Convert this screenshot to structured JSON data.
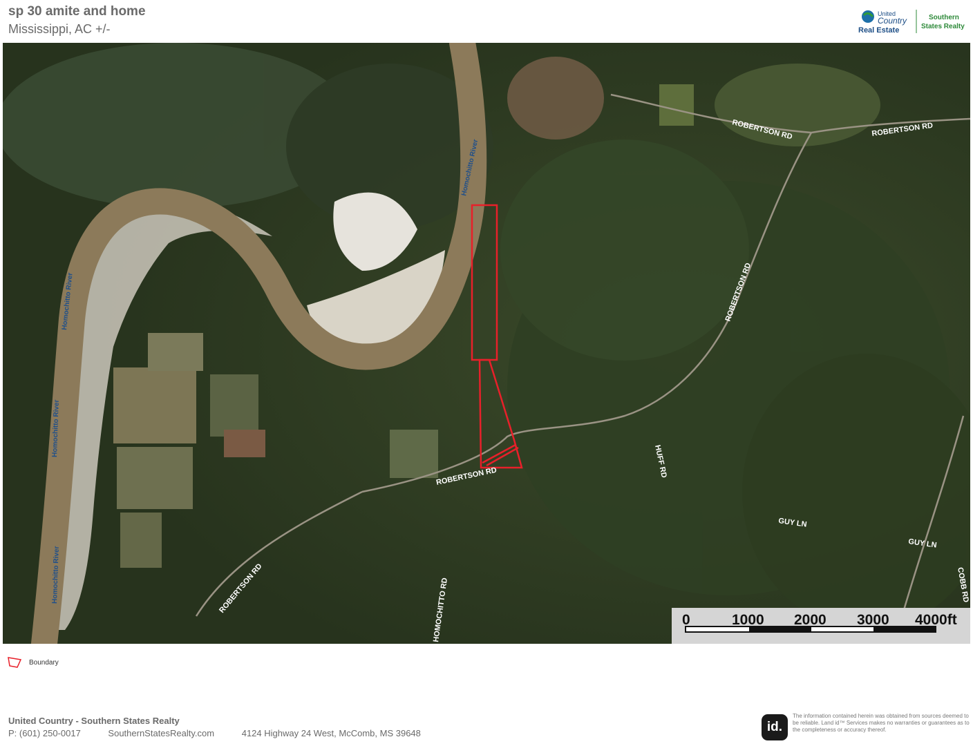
{
  "header": {
    "title": "sp 30 amite and home",
    "subtitle": "Mississippi,  AC +/-"
  },
  "logo": {
    "line1": "United",
    "line2": "Country",
    "line3": "Real Estate",
    "brand1": "Southern",
    "brand2": "States Realty"
  },
  "map": {
    "roads": {
      "robertson_1": "ROBERTSON RD",
      "robertson_2": "ROBERTSON RD",
      "robertson_3": "ROBERTSON RD",
      "robertson_4": "ROBERTSON RD",
      "robertson_5": "ROBERTSON RD",
      "huff": "HUFF RD",
      "guy_1": "GUY LN",
      "guy_2": "GUY LN",
      "cobb": "COBB RD",
      "homochitto": "HOMOCHITTO RD"
    },
    "river_label": "Homochitto River",
    "scale": {
      "ticks": [
        "0",
        "1000",
        "2000",
        "3000",
        "4000ft"
      ]
    },
    "boundary_color": "#e8202a"
  },
  "legend": {
    "label": "Boundary"
  },
  "footer": {
    "company": "United Country - Southern States Realty",
    "phone": "P: (601) 250-0017",
    "website": "SouthernStatesRealty.com",
    "address": "4124 Highway 24 West, McComb, MS 39648",
    "id_logo": "id.",
    "disclaimer": "The information contained herein was obtained from sources deemed to be reliable. Land id™ Services makes no warranties or guarantees as to the completeness or accuracy thereof."
  }
}
